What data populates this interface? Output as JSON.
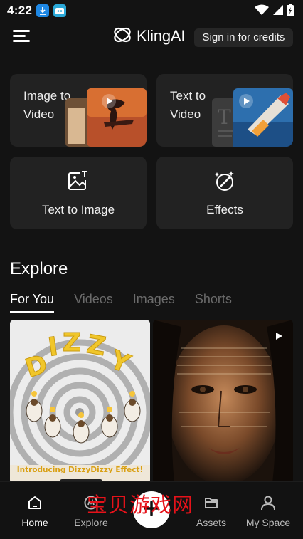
{
  "status_bar": {
    "time": "4:22"
  },
  "header": {
    "logo_text": "KlingAI",
    "signin_label": "Sign in for credits"
  },
  "cards": {
    "image_to_video": "Image to Video",
    "text_to_video": "Text to Video",
    "text_to_image": "Text to Image",
    "effects": "Effects"
  },
  "explore": {
    "title": "Explore",
    "tabs": [
      {
        "label": "For You",
        "active": true
      },
      {
        "label": "Videos",
        "active": false
      },
      {
        "label": "Images",
        "active": false
      },
      {
        "label": "Shorts",
        "active": false
      }
    ],
    "feed": [
      {
        "title_art": "DIZZY",
        "caption": "Introducing DizzyDizzy Effect!"
      },
      {
        "type": "video"
      }
    ]
  },
  "bottom_nav": {
    "items": [
      {
        "label": "Home",
        "active": true
      },
      {
        "label": "Explore",
        "active": false
      },
      {
        "label": "Assets",
        "active": false
      },
      {
        "label": "My Space",
        "active": false
      }
    ]
  },
  "watermark": "宝贝游戏网",
  "colors": {
    "background": "#131313",
    "card": "#222222",
    "accent_red": "#e6121a"
  }
}
